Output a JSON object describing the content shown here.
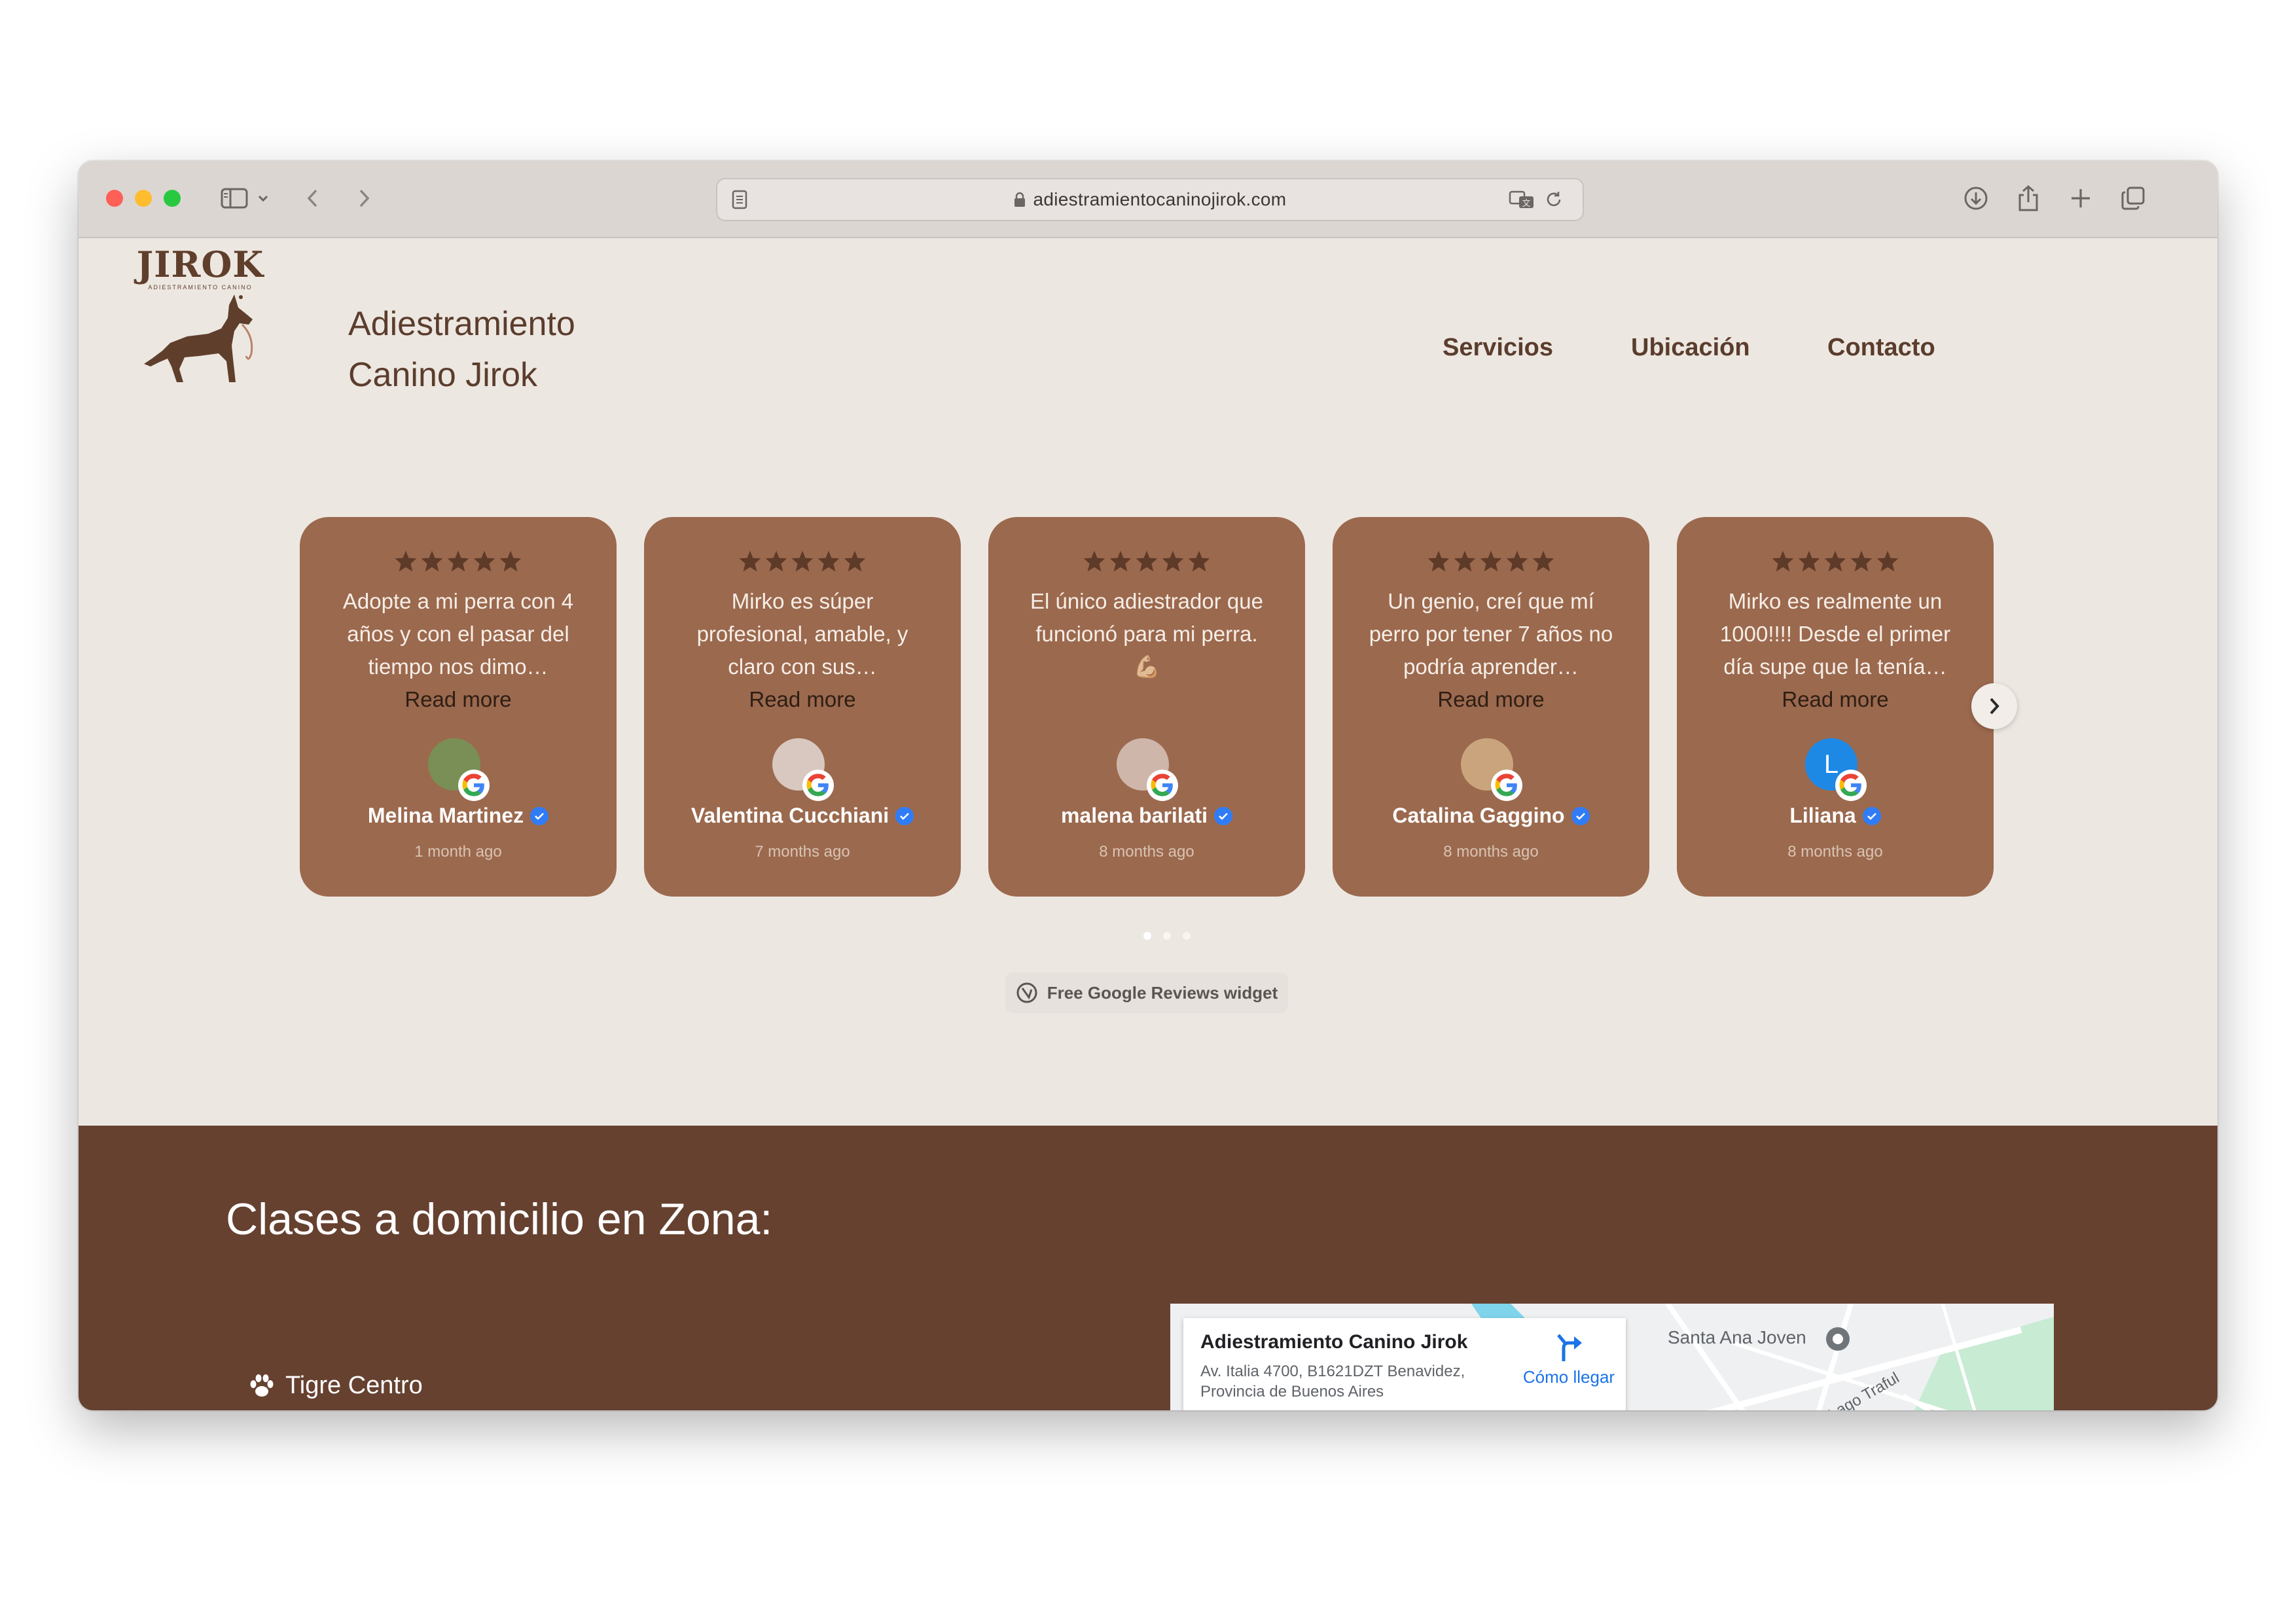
{
  "browser": {
    "url": "adiestramientocaninojirok.com"
  },
  "header": {
    "logo_text": "JIROK",
    "logo_subtext": "ADIESTRAMIENTO CANINO",
    "title_line1": "Adiestramiento",
    "title_line2": "Canino Jirok",
    "nav": [
      "Servicios",
      "Ubicación",
      "Contacto"
    ]
  },
  "reviews": {
    "read_more": "Read more",
    "items": [
      {
        "text": "Adopte a mi perra con 4 años y con el pasar del tiempo nos dimo…",
        "author": "Melina Martinez",
        "date": "1 month ago",
        "read_more": true,
        "avatar": ""
      },
      {
        "text": "Mirko es súper profesional, amable, y claro con sus…",
        "author": "Valentina Cucchiani",
        "date": "7 months ago",
        "read_more": true,
        "avatar": ""
      },
      {
        "text": "El único adiestrador que funcionó para mi perra. 💪🏼",
        "author": "malena barilati",
        "date": "8 months ago",
        "read_more": false,
        "avatar": ""
      },
      {
        "text": "Un genio, creí que mí perro por tener 7 años no podría aprender…",
        "author": "Catalina Gaggino",
        "date": "8 months ago",
        "read_more": true,
        "avatar": ""
      },
      {
        "text": "Mirko es realmente un 1000!!!! Desde el primer día supe que la tenía…",
        "author": "Liliana",
        "date": "8 months ago",
        "read_more": true,
        "avatar": "L"
      }
    ],
    "widget_label": "Free Google Reviews widget"
  },
  "zone": {
    "title": "Clases a domicilio en Zona:",
    "first_item": "Tigre Centro"
  },
  "map": {
    "place_name": "Adiestramiento Canino Jirok",
    "address_line1": "Av. Italia 4700, B1621DZT Benavidez,",
    "address_line2": "Provincia de Buenos Aires",
    "directions_label": "Cómo llegar",
    "label_santa_ana": "Santa Ana Joven",
    "label_lago": "Lago Traful"
  },
  "colors": {
    "card": "#9b694e",
    "page_bg": "#ede7e1",
    "zone_bg": "#664130",
    "brand_text": "#5b3d2d"
  }
}
